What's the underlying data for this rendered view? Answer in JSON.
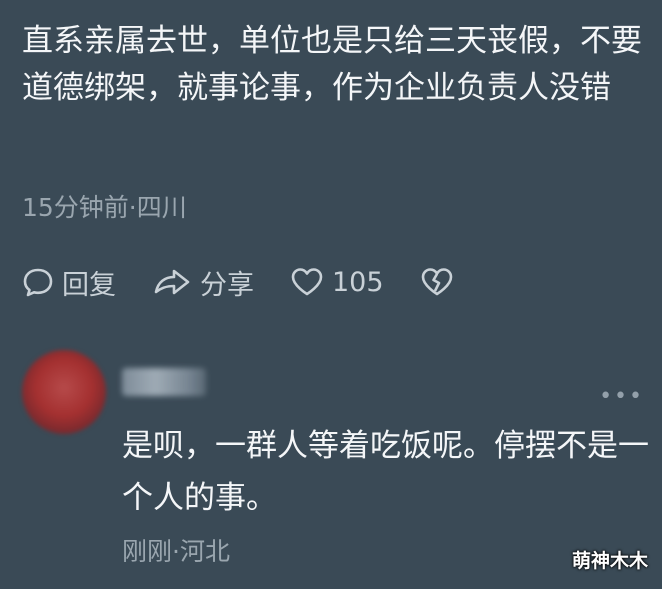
{
  "comment": {
    "text": "直系亲属去世，单位也是只给三天丧假，不要道德绑架，就事论事，作为企业负责人没错",
    "meta": "15分钟前·四川"
  },
  "actions": {
    "reply_label": "回复",
    "share_label": "分享",
    "like_count": "105"
  },
  "reply": {
    "text": "是呗，一群人等着吃饭呢。停摆不是一个人的事。",
    "meta": "刚刚·河北",
    "more_icon": "more-dots-icon"
  },
  "watermark": "萌神木木"
}
